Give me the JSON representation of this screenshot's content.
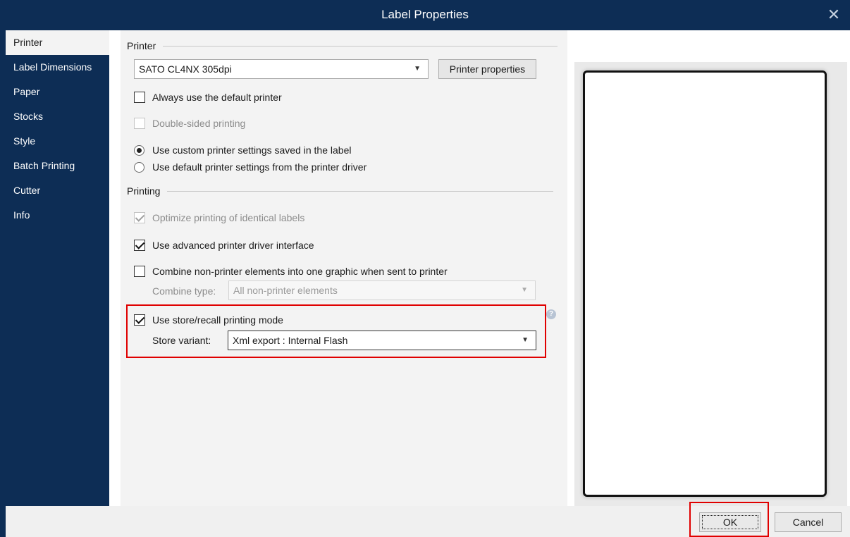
{
  "window": {
    "title": "Label Properties",
    "close_glyph": "✕"
  },
  "sidebar": {
    "items": [
      {
        "label": "Printer",
        "active": true
      },
      {
        "label": "Label Dimensions"
      },
      {
        "label": "Paper"
      },
      {
        "label": "Stocks"
      },
      {
        "label": "Style"
      },
      {
        "label": "Batch Printing"
      },
      {
        "label": "Cutter"
      },
      {
        "label": "Info"
      }
    ]
  },
  "printer_section": {
    "header": "Printer",
    "printer_select": "SATO CL4NX 305dpi",
    "printer_properties_button": "Printer properties",
    "always_default": {
      "label": "Always use the default printer",
      "checked": false
    },
    "double_sided": {
      "label": "Double-sided printing",
      "checked": false,
      "disabled": true
    },
    "settings_radio": [
      {
        "label": "Use custom printer settings saved in the label",
        "checked": true
      },
      {
        "label": "Use default printer settings from the printer driver",
        "checked": false
      }
    ]
  },
  "printing_section": {
    "header": "Printing",
    "optimize": {
      "label": "Optimize printing of identical labels",
      "checked": true,
      "disabled": true
    },
    "advanced_driver": {
      "label": "Use advanced printer driver interface",
      "checked": true
    },
    "combine": {
      "label": "Combine non-printer elements into one graphic when sent to printer",
      "checked": false
    },
    "combine_type": {
      "label": "Combine type:",
      "value": "All non-printer elements",
      "disabled": true
    },
    "store_recall": {
      "label": "Use store/recall printing mode",
      "checked": true
    },
    "store_variant": {
      "label": "Store variant:",
      "value": "Xml export : Internal Flash"
    },
    "help_glyph": "?"
  },
  "dropdown_glyph": "▼",
  "footer": {
    "ok_label": "OK",
    "cancel_label": "Cancel"
  },
  "colors": {
    "sidebar_bg": "#0d2d55",
    "highlight": "#e00000"
  }
}
